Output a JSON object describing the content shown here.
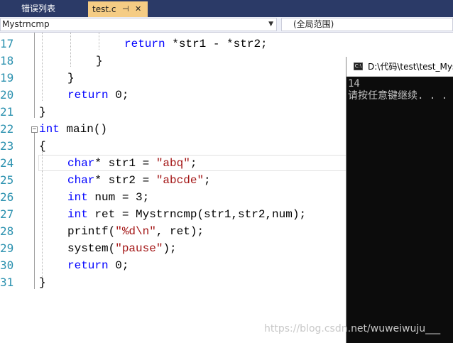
{
  "tabs": {
    "inactive": "错误列表",
    "active": "test.c",
    "pin_glyph": "⊣",
    "close_glyph": "✕"
  },
  "navbar": {
    "function": "Mystrncmp",
    "scope": "(全局范围)"
  },
  "code_lines": [
    {
      "num": "17",
      "parts": [
        {
          "t": "return ",
          "c": "kw"
        },
        {
          "t": "*str1 - *str2;",
          "c": ""
        }
      ]
    },
    {
      "num": "18",
      "parts": [
        {
          "t": "}",
          "c": ""
        }
      ]
    },
    {
      "num": "19",
      "parts": [
        {
          "t": "}",
          "c": ""
        }
      ]
    },
    {
      "num": "20",
      "parts": [
        {
          "t": "return ",
          "c": "kw"
        },
        {
          "t": "0;",
          "c": ""
        }
      ]
    },
    {
      "num": "21",
      "parts": [
        {
          "t": "}",
          "c": ""
        }
      ]
    },
    {
      "num": "22",
      "parts": [
        {
          "t": "int",
          "c": "kw"
        },
        {
          "t": " main()",
          "c": ""
        }
      ]
    },
    {
      "num": "23",
      "parts": [
        {
          "t": "{",
          "c": ""
        }
      ]
    },
    {
      "num": "24",
      "parts": [
        {
          "t": "char",
          "c": "kw"
        },
        {
          "t": "* str1 = ",
          "c": ""
        },
        {
          "t": "\"abq\"",
          "c": "str"
        },
        {
          "t": ";",
          "c": ""
        }
      ]
    },
    {
      "num": "25",
      "parts": [
        {
          "t": "char",
          "c": "kw"
        },
        {
          "t": "* str2 = ",
          "c": ""
        },
        {
          "t": "\"abcde\"",
          "c": "str"
        },
        {
          "t": ";",
          "c": ""
        }
      ]
    },
    {
      "num": "26",
      "parts": [
        {
          "t": "int",
          "c": "kw"
        },
        {
          "t": " num = 3;",
          "c": ""
        }
      ]
    },
    {
      "num": "27",
      "parts": [
        {
          "t": "int",
          "c": "kw"
        },
        {
          "t": " ret = Mystrncmp(str1,str2,num);",
          "c": ""
        }
      ]
    },
    {
      "num": "28",
      "parts": [
        {
          "t": "printf(",
          "c": ""
        },
        {
          "t": "\"%d\\n\"",
          "c": "str"
        },
        {
          "t": ", ret);",
          "c": ""
        }
      ]
    },
    {
      "num": "29",
      "parts": [
        {
          "t": "system(",
          "c": ""
        },
        {
          "t": "\"pause\"",
          "c": "str"
        },
        {
          "t": ");",
          "c": ""
        }
      ]
    },
    {
      "num": "30",
      "parts": [
        {
          "t": "return ",
          "c": "kw"
        },
        {
          "t": "0;",
          "c": ""
        }
      ]
    },
    {
      "num": "31",
      "parts": [
        {
          "t": "}",
          "c": ""
        }
      ]
    }
  ],
  "collapse_glyph": "−",
  "console": {
    "title": "D:\\代码\\test\\test_Mys",
    "icon_text": "C:\\",
    "output_line1": "14",
    "output_line2": "请按任意键继续. . ."
  },
  "watermark": "https://blog.csdn.net/wuweiwuju___"
}
